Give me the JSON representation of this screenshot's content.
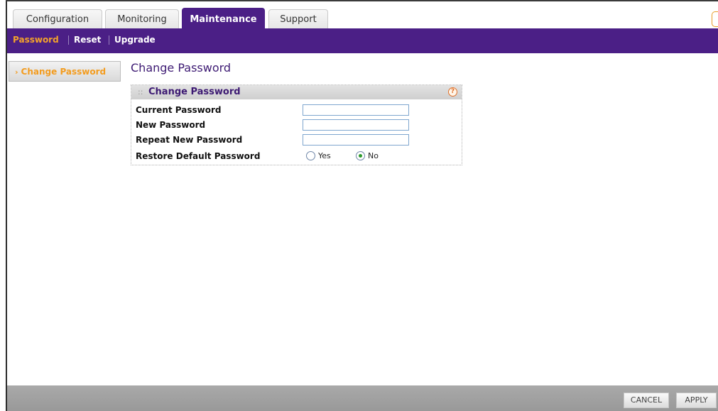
{
  "tabs": [
    {
      "label": "Configuration"
    },
    {
      "label": "Monitoring"
    },
    {
      "label": "Maintenance",
      "active": true
    },
    {
      "label": "Support"
    }
  ],
  "subnav": {
    "items": [
      {
        "label": "Password",
        "active": true
      },
      {
        "label": "Reset"
      },
      {
        "label": "Upgrade"
      }
    ]
  },
  "sidebar": {
    "items": [
      {
        "label": "Change Password",
        "icon": "chevron-right-icon"
      }
    ]
  },
  "main": {
    "title": "Change Password",
    "panel": {
      "title": "Change Password",
      "help_icon": "help-icon",
      "fields": {
        "current_password": {
          "label": "Current Password",
          "value": ""
        },
        "new_password": {
          "label": "New Password",
          "value": ""
        },
        "repeat_new_password": {
          "label": "Repeat New Password",
          "value": ""
        }
      },
      "restore_default": {
        "label": "Restore Default Password",
        "options": [
          "Yes",
          "No"
        ],
        "selected": "No"
      }
    }
  },
  "footer": {
    "cancel_label": "CANCEL",
    "apply_label": "APPLY"
  },
  "colors": {
    "brand_purple": "#4b1f86",
    "accent_orange": "#f4a32a",
    "title_purple": "#3d1a73",
    "footer_gray": "#a9a9a9"
  }
}
